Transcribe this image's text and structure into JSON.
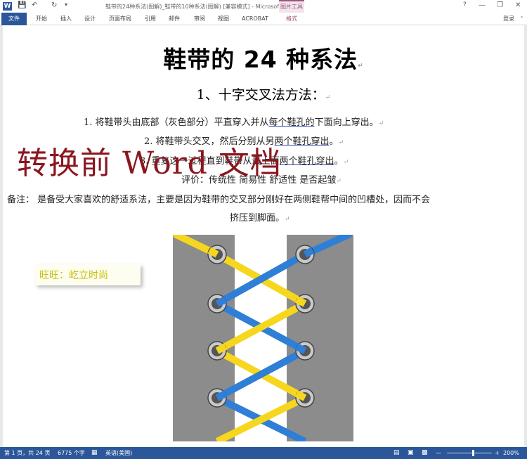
{
  "titlebar": {
    "window_title": "鞋带的24种系法(图解)_鞋带的10种系法(图解) [兼容模式] - Microsoft Word",
    "context_tab": "图片工具",
    "help_glyph": "?",
    "minimize_glyph": "—",
    "restore_glyph": "❐",
    "close_glyph": "✕"
  },
  "ribbon": {
    "tabs": [
      "文件",
      "开始",
      "插入",
      "设计",
      "页面布局",
      "引用",
      "邮件",
      "审阅",
      "视图",
      "ACROBAT",
      "格式"
    ],
    "login": "登录"
  },
  "document": {
    "title": "鞋带的 24 种系法",
    "heading": "1、十字交叉法方法：",
    "step1": {
      "pre": "1. 将鞋带头由底部（灰色部分）平直穿入并从",
      "u1": "每个鞋孔的",
      "post": "下面向上穿出。"
    },
    "step2": {
      "pre": "2. 将鞋带头交叉，然后分别从另",
      "u1": "两个鞋孔穿出",
      "post": "。"
    },
    "step3": {
      "pre": "3. 重复这一过程直到鞋带从最上面",
      "u1": "两个鞋孔穿出",
      "post": "。"
    },
    "evaluation": "评价：传统性  简易性  舒适性  是否起皱",
    "note_line1": "备注：  是备受大家喜欢的舒适系法，主要是因为鞋带的交叉部分刚好在两侧鞋帮中间的凹槽处，因而不会",
    "note_line2": "挤压到脚面。",
    "paragraph_mark": "↵",
    "watermark": "转换前 Word 文档",
    "stamp": "旺旺：屹立时尚"
  },
  "statusbar": {
    "page": "第 1 页，共 24 页",
    "words": "6775 个字",
    "language": "英语(美国)",
    "zoom": "200%"
  },
  "colors": {
    "word_blue": "#2b579a",
    "context_pink": "#a0537c",
    "watermark_red": "#8b1620",
    "lace_yellow": "#f7d61e",
    "lace_blue": "#2f7fd6",
    "shoe_gray": "#8c8c8c"
  }
}
